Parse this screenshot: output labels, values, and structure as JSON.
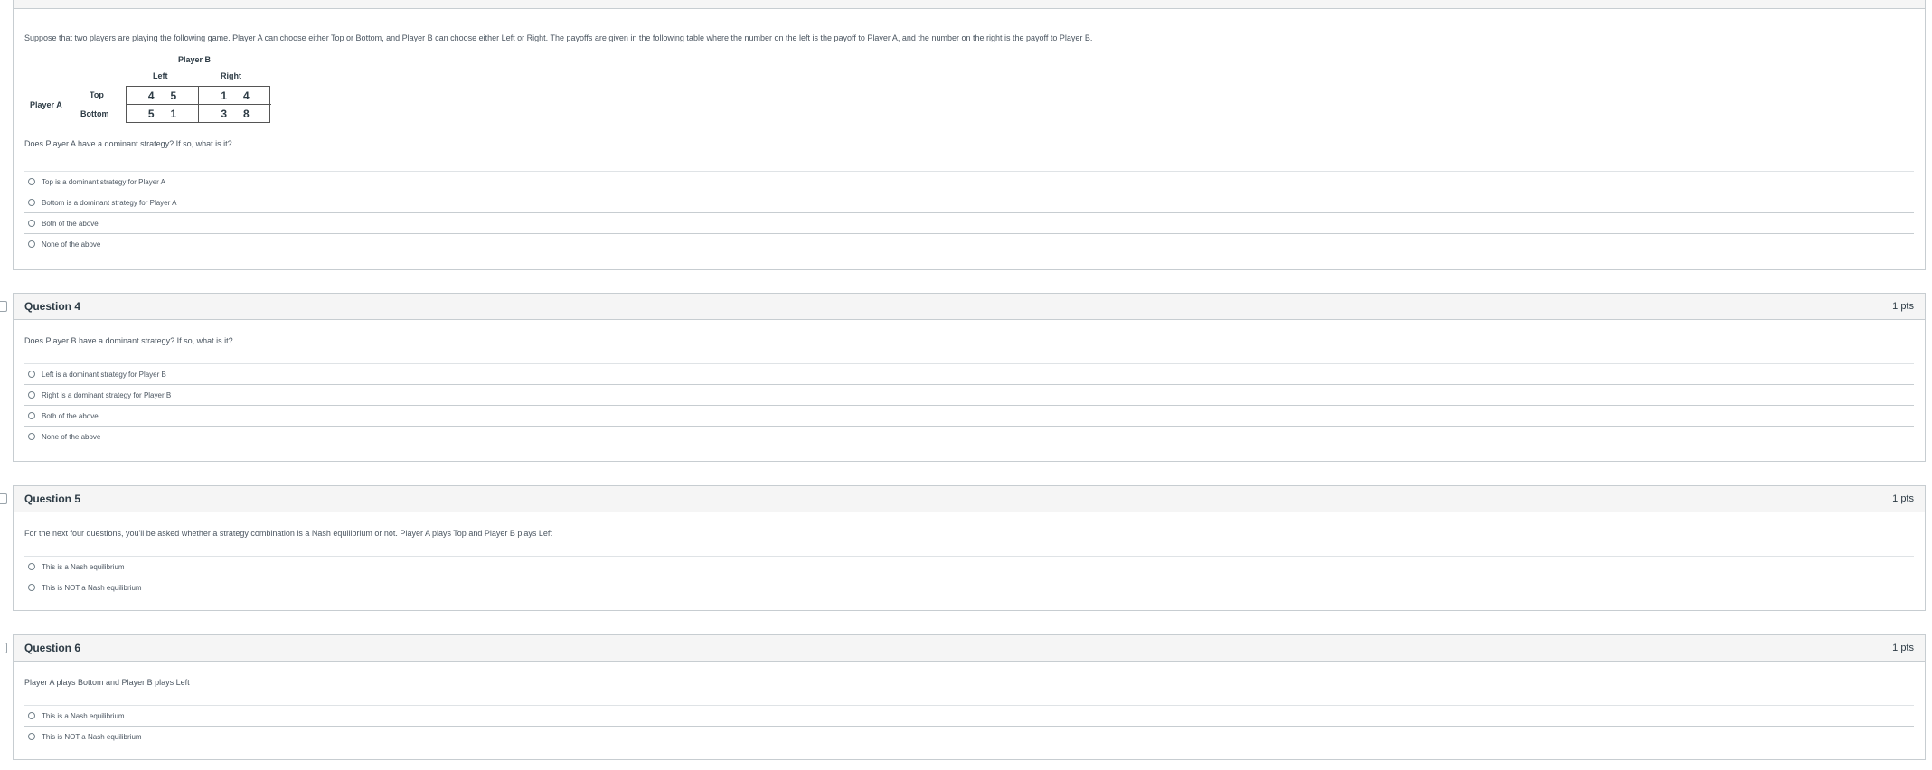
{
  "q3": {
    "prompt": "Suppose that two players are playing the following game. Player A can choose either Top or Bottom, and Player B can choose either Left or Right. The payoffs are given in the following table where the number on the left is the payoff to Player A, and the number on the right is the payoff to Player B.",
    "table": {
      "col_player": "Player B",
      "row_player": "Player A",
      "col_left": "Left",
      "col_right": "Right",
      "row_top": "Top",
      "row_bottom": "Bottom",
      "top_left": [
        "4",
        "5"
      ],
      "top_right": [
        "1",
        "4"
      ],
      "bottom_left": [
        "5",
        "1"
      ],
      "bottom_right": [
        "3",
        "8"
      ]
    },
    "question": "Does Player A have a dominant strategy? If so, what is it?",
    "answers": [
      "Top is a dominant strategy for Player A",
      "Bottom is a dominant strategy for Player A",
      "Both of the above",
      "None of the above"
    ]
  },
  "q4": {
    "title": "Question 4",
    "points": "1 pts",
    "question": "Does Player B have a dominant strategy? If so, what is it?",
    "answers": [
      "Left is a dominant strategy for Player B",
      "Right is a dominant strategy for Player B",
      "Both of the above",
      "None of the above"
    ]
  },
  "q5": {
    "title": "Question 5",
    "points": "1 pts",
    "question": "For the next four questions, you'll be asked whether a strategy combination is a Nash equilibrium or not. Player A plays Top and Player B plays Left",
    "answers": [
      "This is a Nash equilibrium",
      "This is NOT a Nash equilibrium"
    ]
  },
  "q6": {
    "title": "Question 6",
    "points": "1 pts",
    "question": "Player A plays Bottom and Player B plays Left",
    "answers": [
      "This is a Nash equilibrium",
      "This is NOT a Nash equilibrium"
    ]
  }
}
